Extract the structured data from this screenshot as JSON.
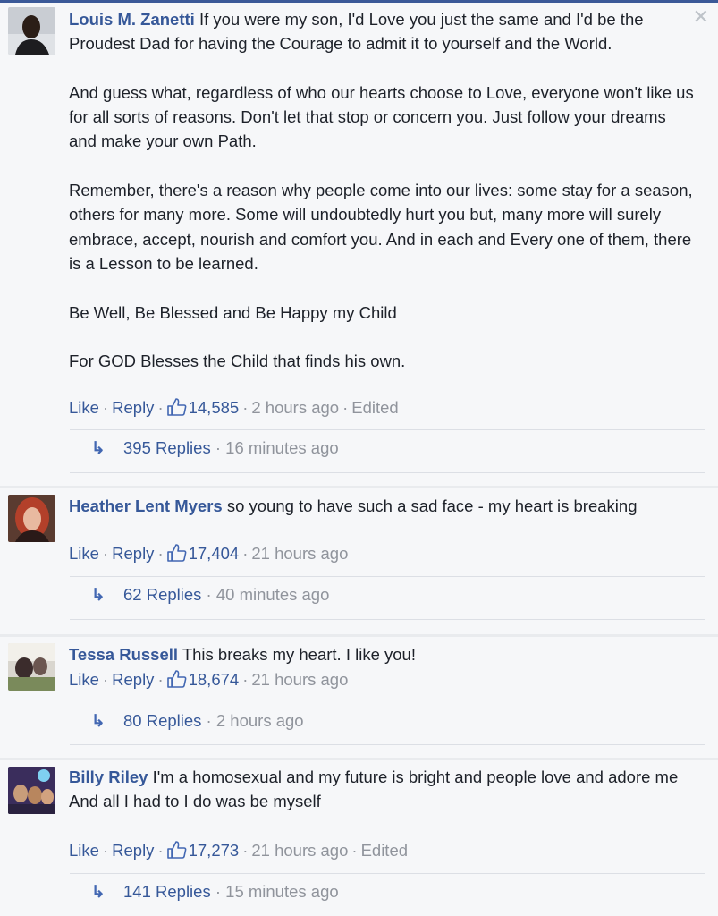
{
  "comments": [
    {
      "author": "Louis M. Zanetti",
      "paragraphs": [
        " If you were my son, I'd Love you just the same and I'd be the Proudest Dad for having the Courage to admit it to yourself and the World.",
        "And guess what, regardless of who our hearts choose to Love, everyone won't like us for all sorts of reasons. Don't let that stop or concern you. Just follow your dreams and make your own Path.",
        "Remember, there's a reason why people come into our lives: some stay for a season, others for many more. Some will undoubtedly hurt you but, many more will surely embrace, accept, nourish and comfort you. And in each and Every one of them, there is a Lesson to be learned.",
        "Be Well, Be Blessed and Be Happy my Child",
        "For GOD Blesses the Child that finds his own."
      ],
      "like_label": "Like",
      "reply_label": "Reply",
      "likes": "14,585",
      "time": "2 hours ago",
      "edited": "Edited",
      "replies_label": "395 Replies",
      "replies_time": "16 minutes ago",
      "close": "✕"
    },
    {
      "author": "Heather Lent Myers",
      "paragraphs": [
        " so young to have such a sad face - my heart is breaking"
      ],
      "like_label": "Like",
      "reply_label": "Reply",
      "likes": "17,404",
      "time": "21 hours ago",
      "replies_label": "62 Replies",
      "replies_time": "40 minutes ago"
    },
    {
      "author": "Tessa Russell",
      "paragraphs": [
        " This breaks my heart. I like you!"
      ],
      "like_label": "Like",
      "reply_label": "Reply",
      "likes": "18,674",
      "time": "21 hours ago",
      "replies_label": "80 Replies",
      "replies_time": "2 hours ago"
    },
    {
      "author": "Billy Riley",
      "paragraphs": [
        " I'm a homosexual and my future is bright and people love and adore me",
        "And all I had to I do was be myself"
      ],
      "like_label": "Like",
      "reply_label": "Reply",
      "likes": "17,273",
      "time": "21 hours ago",
      "edited": "Edited",
      "replies_label": "141 Replies",
      "replies_time": "15 minutes ago"
    }
  ],
  "icons": {
    "like": "thumbs-up-icon",
    "reply_arrow": "reply-arrow-icon",
    "close": "close-icon"
  },
  "colors": {
    "link": "#365899",
    "meta": "#90949c",
    "background": "#f6f7f9"
  }
}
